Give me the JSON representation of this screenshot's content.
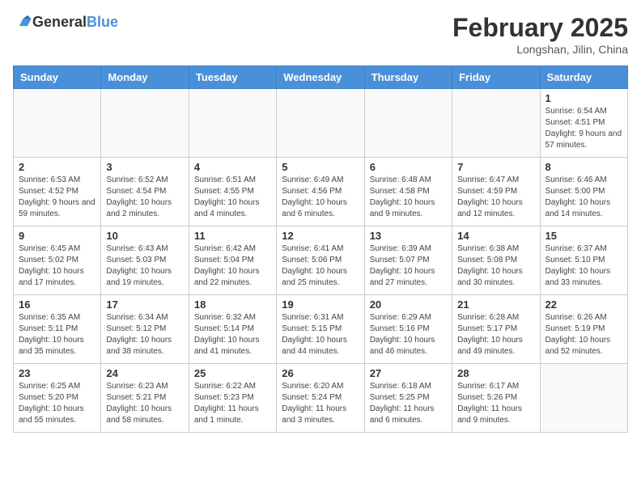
{
  "header": {
    "logo": {
      "general": "General",
      "blue": "Blue"
    },
    "title": "February 2025",
    "location": "Longshan, Jilin, China"
  },
  "weekdays": [
    "Sunday",
    "Monday",
    "Tuesday",
    "Wednesday",
    "Thursday",
    "Friday",
    "Saturday"
  ],
  "weeks": [
    {
      "days": [
        {
          "num": "",
          "info": ""
        },
        {
          "num": "",
          "info": ""
        },
        {
          "num": "",
          "info": ""
        },
        {
          "num": "",
          "info": ""
        },
        {
          "num": "",
          "info": ""
        },
        {
          "num": "",
          "info": ""
        },
        {
          "num": "1",
          "info": "Sunrise: 6:54 AM\nSunset: 4:51 PM\nDaylight: 9 hours and 57 minutes."
        }
      ]
    },
    {
      "days": [
        {
          "num": "2",
          "info": "Sunrise: 6:53 AM\nSunset: 4:52 PM\nDaylight: 9 hours and 59 minutes."
        },
        {
          "num": "3",
          "info": "Sunrise: 6:52 AM\nSunset: 4:54 PM\nDaylight: 10 hours and 2 minutes."
        },
        {
          "num": "4",
          "info": "Sunrise: 6:51 AM\nSunset: 4:55 PM\nDaylight: 10 hours and 4 minutes."
        },
        {
          "num": "5",
          "info": "Sunrise: 6:49 AM\nSunset: 4:56 PM\nDaylight: 10 hours and 6 minutes."
        },
        {
          "num": "6",
          "info": "Sunrise: 6:48 AM\nSunset: 4:58 PM\nDaylight: 10 hours and 9 minutes."
        },
        {
          "num": "7",
          "info": "Sunrise: 6:47 AM\nSunset: 4:59 PM\nDaylight: 10 hours and 12 minutes."
        },
        {
          "num": "8",
          "info": "Sunrise: 6:46 AM\nSunset: 5:00 PM\nDaylight: 10 hours and 14 minutes."
        }
      ]
    },
    {
      "days": [
        {
          "num": "9",
          "info": "Sunrise: 6:45 AM\nSunset: 5:02 PM\nDaylight: 10 hours and 17 minutes."
        },
        {
          "num": "10",
          "info": "Sunrise: 6:43 AM\nSunset: 5:03 PM\nDaylight: 10 hours and 19 minutes."
        },
        {
          "num": "11",
          "info": "Sunrise: 6:42 AM\nSunset: 5:04 PM\nDaylight: 10 hours and 22 minutes."
        },
        {
          "num": "12",
          "info": "Sunrise: 6:41 AM\nSunset: 5:06 PM\nDaylight: 10 hours and 25 minutes."
        },
        {
          "num": "13",
          "info": "Sunrise: 6:39 AM\nSunset: 5:07 PM\nDaylight: 10 hours and 27 minutes."
        },
        {
          "num": "14",
          "info": "Sunrise: 6:38 AM\nSunset: 5:08 PM\nDaylight: 10 hours and 30 minutes."
        },
        {
          "num": "15",
          "info": "Sunrise: 6:37 AM\nSunset: 5:10 PM\nDaylight: 10 hours and 33 minutes."
        }
      ]
    },
    {
      "days": [
        {
          "num": "16",
          "info": "Sunrise: 6:35 AM\nSunset: 5:11 PM\nDaylight: 10 hours and 35 minutes."
        },
        {
          "num": "17",
          "info": "Sunrise: 6:34 AM\nSunset: 5:12 PM\nDaylight: 10 hours and 38 minutes."
        },
        {
          "num": "18",
          "info": "Sunrise: 6:32 AM\nSunset: 5:14 PM\nDaylight: 10 hours and 41 minutes."
        },
        {
          "num": "19",
          "info": "Sunrise: 6:31 AM\nSunset: 5:15 PM\nDaylight: 10 hours and 44 minutes."
        },
        {
          "num": "20",
          "info": "Sunrise: 6:29 AM\nSunset: 5:16 PM\nDaylight: 10 hours and 46 minutes."
        },
        {
          "num": "21",
          "info": "Sunrise: 6:28 AM\nSunset: 5:17 PM\nDaylight: 10 hours and 49 minutes."
        },
        {
          "num": "22",
          "info": "Sunrise: 6:26 AM\nSunset: 5:19 PM\nDaylight: 10 hours and 52 minutes."
        }
      ]
    },
    {
      "days": [
        {
          "num": "23",
          "info": "Sunrise: 6:25 AM\nSunset: 5:20 PM\nDaylight: 10 hours and 55 minutes."
        },
        {
          "num": "24",
          "info": "Sunrise: 6:23 AM\nSunset: 5:21 PM\nDaylight: 10 hours and 58 minutes."
        },
        {
          "num": "25",
          "info": "Sunrise: 6:22 AM\nSunset: 5:23 PM\nDaylight: 11 hours and 1 minute."
        },
        {
          "num": "26",
          "info": "Sunrise: 6:20 AM\nSunset: 5:24 PM\nDaylight: 11 hours and 3 minutes."
        },
        {
          "num": "27",
          "info": "Sunrise: 6:18 AM\nSunset: 5:25 PM\nDaylight: 11 hours and 6 minutes."
        },
        {
          "num": "28",
          "info": "Sunrise: 6:17 AM\nSunset: 5:26 PM\nDaylight: 11 hours and 9 minutes."
        },
        {
          "num": "",
          "info": ""
        }
      ]
    }
  ]
}
